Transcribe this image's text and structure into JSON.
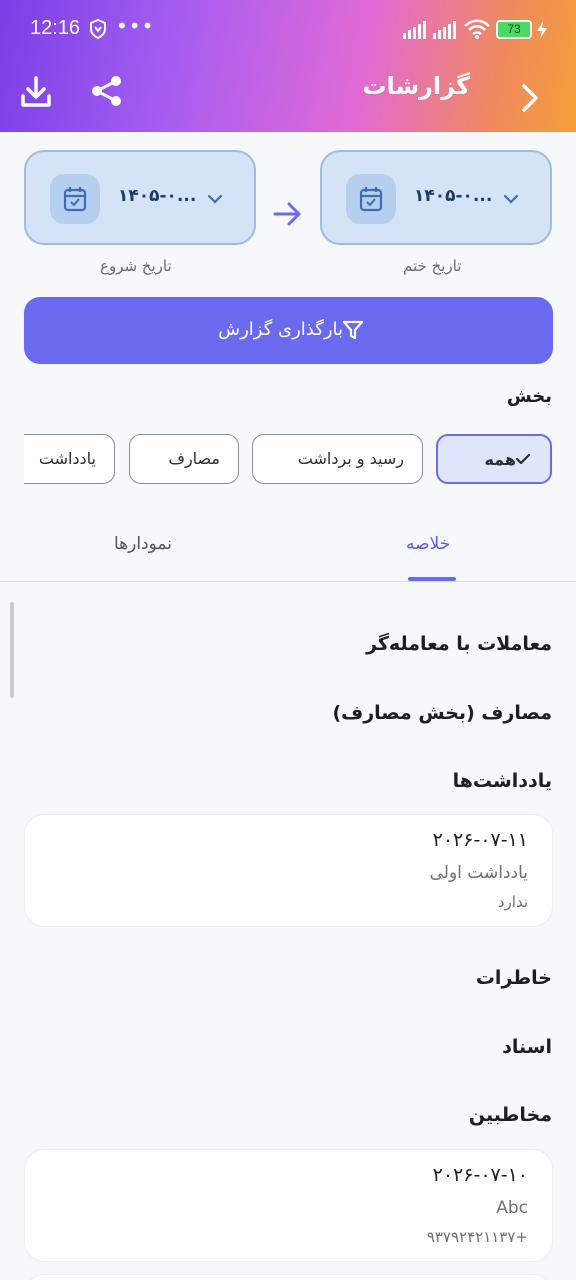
{
  "status_bar": {
    "time": "12:16",
    "dots": "•••",
    "battery": "73"
  },
  "header": {
    "title": "گزارشات",
    "icons": [
      "download-icon",
      "share-icon",
      "chevron-right-icon"
    ],
    "gradient": [
      "#7b3fe6",
      "#e06ad6",
      "#f2a038"
    ]
  },
  "dates": {
    "end": {
      "value": "۱۴۰۵-۰...",
      "label": "تاریخ ختم"
    },
    "start": {
      "value": "۱۴۰۵-۰...",
      "label": "تاریخ شروع"
    }
  },
  "load_button": {
    "label": "بارگذاری گزارش"
  },
  "section": {
    "label": "بخش",
    "chips": [
      {
        "label": "همه",
        "selected": true
      },
      {
        "label": "رسید و برداشت",
        "selected": false
      },
      {
        "label": "مصارف",
        "selected": false
      },
      {
        "label": "یادداشت",
        "selected": false
      }
    ]
  },
  "tabs": {
    "summary": "خلاصه",
    "charts": "نمودارها",
    "active": "summary"
  },
  "content": {
    "trader_transactions": "معاملات با معامله‌گر",
    "expenses": "مصارف (بخش مصارف)",
    "notes_title": "یادداشت‌ها",
    "note_card": {
      "date": "۲۰۲۶-۰۷-۱۱",
      "title": "یادداشت اولی",
      "subtitle": "ندارد"
    },
    "memories": "خاطرات",
    "documents": "اسناد",
    "contacts_title": "مخاطبین",
    "contact_card": {
      "date": "۲۰۲۶-۰۷-۱۰",
      "name": "Abc",
      "phone": "۹۳۷۹۲۴۲۱۱۳۷+"
    }
  },
  "colors": {
    "accent": "#6a6aef",
    "date_box": "#d4e3f5"
  }
}
